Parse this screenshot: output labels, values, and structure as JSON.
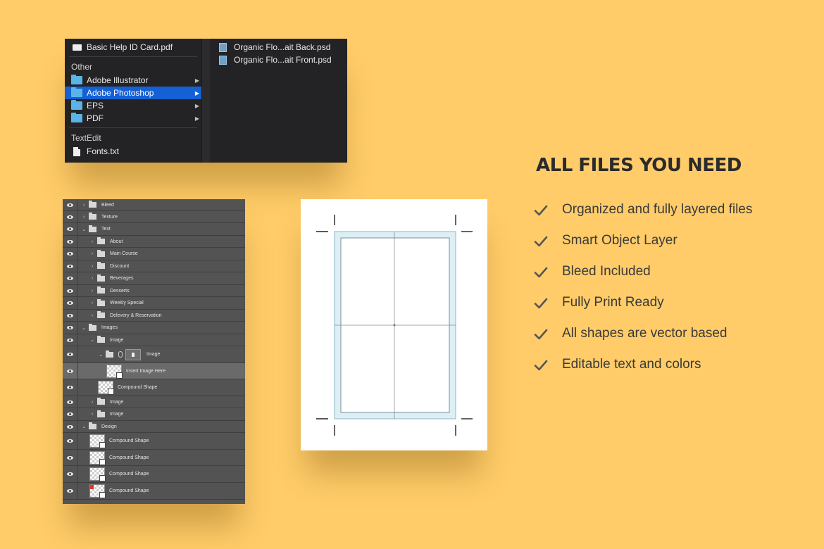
{
  "finder": {
    "top_file": "Basic Help ID Card.pdf",
    "other_header": "Other",
    "folders": [
      {
        "label": "Adobe Illustrator",
        "selected": false
      },
      {
        "label": "Adobe Photoshop",
        "selected": true
      },
      {
        "label": "EPS",
        "selected": false
      },
      {
        "label": "PDF",
        "selected": false
      }
    ],
    "textedit_header": "TextEdit",
    "text_file": "Fonts.txt",
    "submenu_files": [
      "Organic Flo...ait Back.psd",
      "Organic Flo...ait Front.psd"
    ],
    "arrow_glyph": "▶",
    "colors": {
      "selection": "#1560D4",
      "folder": "#5AB4E6",
      "menu_bg": "#232325"
    }
  },
  "layers": {
    "rows": [
      {
        "label": "Bleed",
        "kind": "folder",
        "chev": "›"
      },
      {
        "label": "Texture",
        "kind": "folder",
        "chev": "›"
      },
      {
        "label": "Text",
        "kind": "folder-open",
        "chev": "⌄"
      },
      {
        "label": "About",
        "kind": "folder",
        "chev": "›"
      },
      {
        "label": "Main Course",
        "kind": "folder",
        "chev": "›"
      },
      {
        "label": "Discount",
        "kind": "folder",
        "chev": "›"
      },
      {
        "label": "Beverages",
        "kind": "folder",
        "chev": "›"
      },
      {
        "label": "Desserts",
        "kind": "folder",
        "chev": "›"
      },
      {
        "label": "Weekly Special",
        "kind": "folder",
        "chev": "›"
      },
      {
        "label": "Delevery & Reservation",
        "kind": "folder",
        "chev": "›"
      },
      {
        "label": "Images",
        "kind": "folder-open",
        "chev": "⌄"
      },
      {
        "label": "Image",
        "kind": "folder-open",
        "chev": "⌄"
      },
      {
        "label": "Image",
        "kind": "smart",
        "chev": "⌄"
      },
      {
        "label": "Insert Image Here",
        "kind": "layer",
        "selected": true
      },
      {
        "label": "Compound Shape",
        "kind": "layer"
      },
      {
        "label": "Image",
        "kind": "folder",
        "chev": "›"
      },
      {
        "label": "Image",
        "kind": "folder",
        "chev": "›"
      },
      {
        "label": "Design",
        "kind": "folder-open",
        "chev": "⌄"
      },
      {
        "label": "Compound Shape",
        "kind": "layer"
      },
      {
        "label": "Compound Shape",
        "kind": "layer"
      },
      {
        "label": "Compound Shape",
        "kind": "layer"
      },
      {
        "label": "Compound Shape",
        "kind": "layer",
        "red": true
      }
    ]
  },
  "features": {
    "title": "ALL FILES YOU NEED",
    "items": [
      "Organized and fully layered files",
      "Smart Object Layer",
      "Bleed Included",
      "Fully Print Ready",
      "All shapes are vector based",
      "Editable text and colors"
    ],
    "check_icon": "checkmark-icon",
    "check_color": "#555555"
  },
  "colors": {
    "background": "#FFCC69",
    "bleed": "#DCEFF5"
  }
}
